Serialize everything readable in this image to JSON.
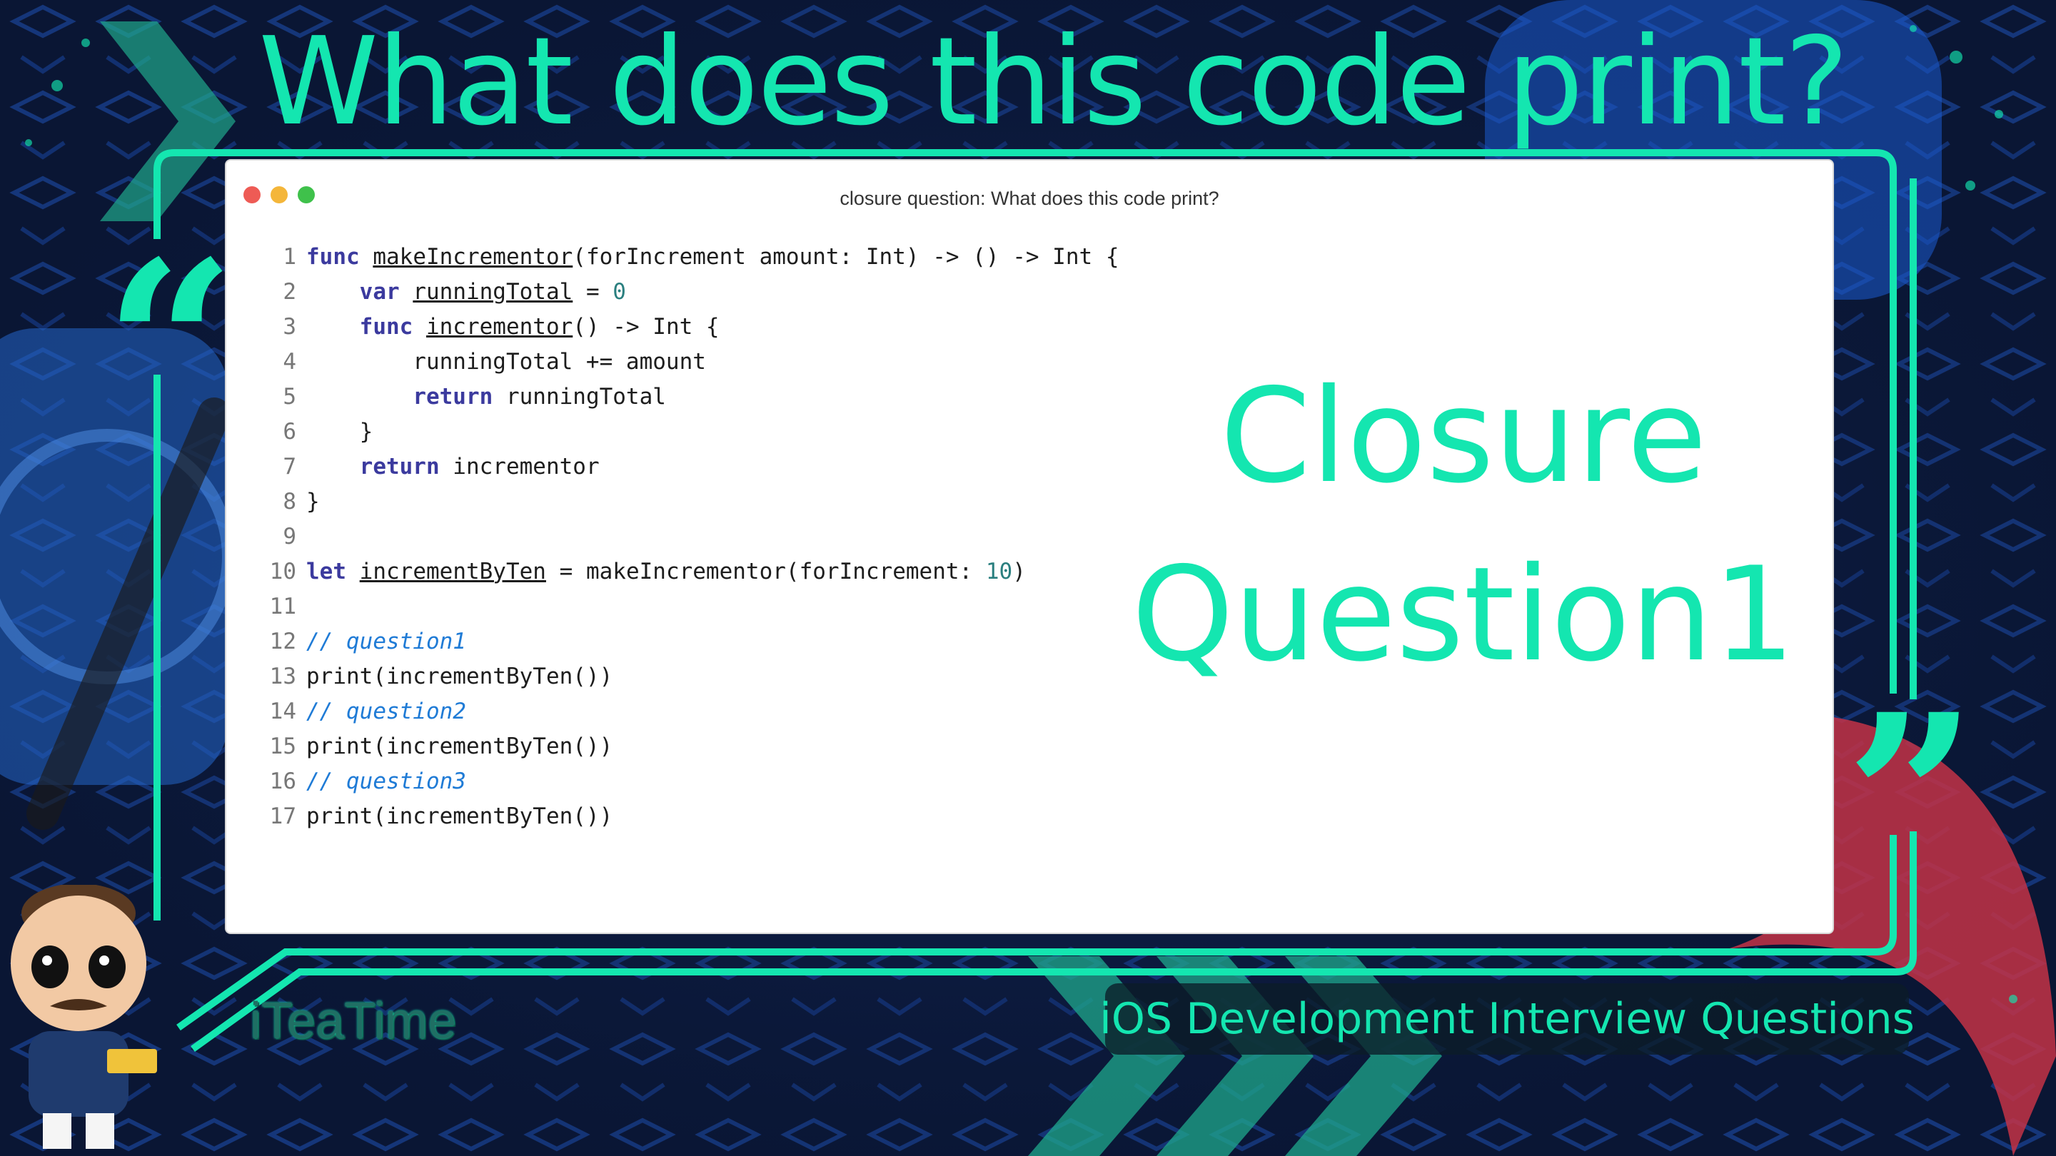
{
  "headline": "What does this code print?",
  "window": {
    "title": "closure question: What does this code print?",
    "code_lines": [
      {
        "n": "1",
        "tokens": [
          {
            "t": "func",
            "k": "kw"
          },
          {
            "t": " "
          },
          {
            "t": "makeIncrementor",
            "k": "decl"
          },
          {
            "t": "(forIncrement amount: Int) -> () -> Int {"
          }
        ]
      },
      {
        "n": "2",
        "tokens": [
          {
            "t": "    "
          },
          {
            "t": "var",
            "k": "kw"
          },
          {
            "t": " "
          },
          {
            "t": "runningTotal",
            "k": "decl"
          },
          {
            "t": " = "
          },
          {
            "t": "0",
            "k": "num"
          }
        ]
      },
      {
        "n": "3",
        "tokens": [
          {
            "t": "    "
          },
          {
            "t": "func",
            "k": "kw"
          },
          {
            "t": " "
          },
          {
            "t": "incrementor",
            "k": "decl"
          },
          {
            "t": "() -> Int {"
          }
        ]
      },
      {
        "n": "4",
        "tokens": [
          {
            "t": "        runningTotal += amount"
          }
        ]
      },
      {
        "n": "5",
        "tokens": [
          {
            "t": "        "
          },
          {
            "t": "return",
            "k": "kw"
          },
          {
            "t": " runningTotal"
          }
        ]
      },
      {
        "n": "6",
        "tokens": [
          {
            "t": "    }"
          }
        ]
      },
      {
        "n": "7",
        "tokens": [
          {
            "t": "    "
          },
          {
            "t": "return",
            "k": "kw"
          },
          {
            "t": " incrementor"
          }
        ]
      },
      {
        "n": "8",
        "tokens": [
          {
            "t": "}"
          }
        ]
      },
      {
        "n": "9",
        "tokens": []
      },
      {
        "n": "10",
        "tokens": [
          {
            "t": "let",
            "k": "kw"
          },
          {
            "t": " "
          },
          {
            "t": "incrementByTen",
            "k": "decl"
          },
          {
            "t": " = makeIncrementor(forIncrement: "
          },
          {
            "t": "10",
            "k": "num"
          },
          {
            "t": ")"
          }
        ]
      },
      {
        "n": "11",
        "tokens": []
      },
      {
        "n": "12",
        "tokens": [
          {
            "t": "// question1",
            "k": "comment"
          }
        ]
      },
      {
        "n": "13",
        "tokens": [
          {
            "t": "print(incrementByTen())"
          }
        ]
      },
      {
        "n": "14",
        "tokens": [
          {
            "t": "// question2",
            "k": "comment"
          }
        ]
      },
      {
        "n": "15",
        "tokens": [
          {
            "t": "print(incrementByTen())"
          }
        ]
      },
      {
        "n": "16",
        "tokens": [
          {
            "t": "// question3",
            "k": "comment"
          }
        ]
      },
      {
        "n": "17",
        "tokens": [
          {
            "t": "print(incrementByTen())"
          }
        ]
      }
    ]
  },
  "badge": {
    "line1": "Closure",
    "line2": "Question1"
  },
  "quotes": {
    "open": "“",
    "close": "”"
  },
  "brand": "iTeaTime",
  "subtitle": "iOS Development Interview Questions",
  "colors": {
    "accent": "#14e6b0",
    "background": "#0a1634",
    "badge_fill": "#5a5a5a",
    "keyword": "#3b3a9e",
    "comment": "#1f7bd6",
    "number": "#2a7f7f"
  },
  "icons": {
    "traffic_lights": [
      "close-dot",
      "minimize-dot",
      "zoom-dot"
    ],
    "mascot": "mascot-figure",
    "decor": [
      "chevron-arrows",
      "xcode-logo",
      "swift-logo"
    ]
  }
}
